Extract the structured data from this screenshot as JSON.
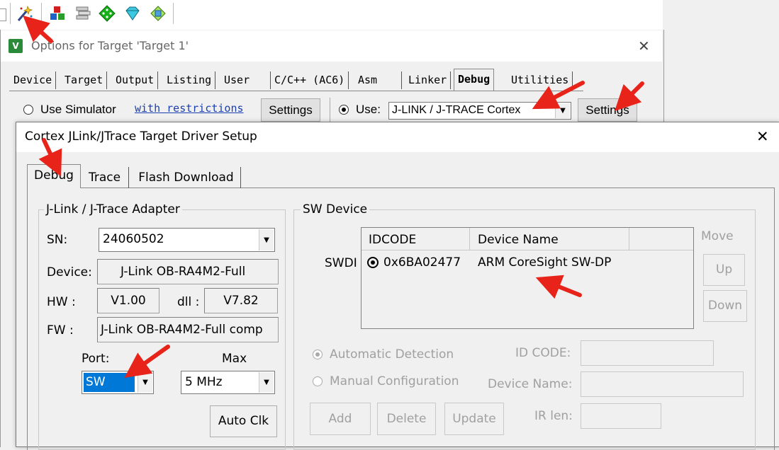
{
  "toolbar": {
    "icons": [
      "magic-wand-icon",
      "options-for-target-icon",
      "stack-icon",
      "dice-icon",
      "gem-icon",
      "pack-installer-icon"
    ]
  },
  "options_window": {
    "title": "Options for Target 'Target 1'",
    "close_glyph": "✕",
    "tabs": [
      "Device",
      "Target",
      "Output",
      "Listing",
      "User",
      "C/C++ (AC6)",
      "Asm",
      "Linker",
      "Debug",
      "Utilities"
    ],
    "active_tab": "Debug",
    "use_simulator_label": "Use Simulator",
    "with_restrictions_link": "with restrictions",
    "settings_label": "Settings",
    "use_label": "Use:",
    "debugger_value": "J-LINK / J-TRACE Cortex",
    "settings_label_2": "Settings"
  },
  "dialog": {
    "title": "Cortex JLink/JTrace Target Driver Setup",
    "close_glyph": "✕",
    "tabs": [
      "Debug",
      "Trace",
      "Flash Download"
    ],
    "active_tab": "Debug",
    "adapter": {
      "group_label": "J-Link / J-Trace Adapter",
      "sn_label": "SN:",
      "sn_value": "24060502",
      "device_label": "Device:",
      "device_value": "J-Link OB-RA4M2-Full",
      "hw_label": "HW :",
      "hw_value": "V1.00",
      "dll_label": "dll :",
      "dll_value": "V7.82",
      "fw_label": "FW :",
      "fw_value": "J-Link OB-RA4M2-Full comp",
      "port_label": "Port:",
      "port_value": "SW",
      "max_label": "Max",
      "max_value": "5 MHz",
      "auto_clk_label": "Auto Clk"
    },
    "sw_device": {
      "group_label": "SW Device",
      "swdi_label": "SWDI",
      "columns": [
        "IDCODE",
        "Device Name"
      ],
      "rows": [
        {
          "idcode": "0x6BA02477",
          "device_name": "ARM CoreSight SW-DP"
        }
      ],
      "move_label": "Move",
      "up_label": "Up",
      "down_label": "Down",
      "automatic_detection_label": "Automatic Detection",
      "manual_configuration_label": "Manual Configuration",
      "id_code_label": "ID CODE:",
      "device_name_label": "Device Name:",
      "ir_len_label": "IR len:",
      "add_label": "Add",
      "delete_label": "Delete",
      "update_label": "Update"
    }
  },
  "colors": {
    "annotation_red": "#e8231a",
    "selection_blue": "#0078d7",
    "link_blue": "#1a3fb0"
  }
}
